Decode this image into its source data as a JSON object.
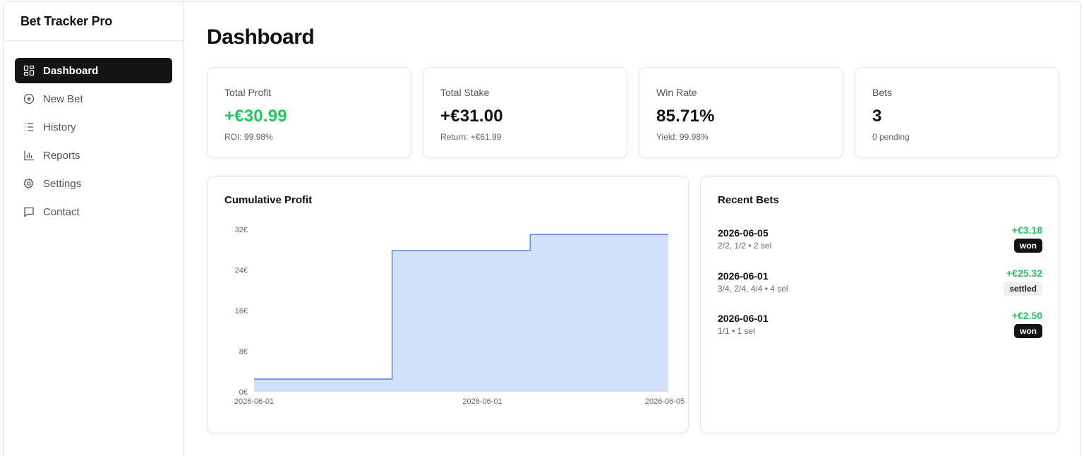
{
  "sidebar": {
    "brand": "Bet Tracker Pro",
    "items": [
      {
        "label": "Dashboard",
        "icon": "dashboard-icon",
        "active": true
      },
      {
        "label": "New Bet",
        "icon": "plus-circle-icon",
        "active": false
      },
      {
        "label": "History",
        "icon": "list-icon",
        "active": false
      },
      {
        "label": "Reports",
        "icon": "bar-chart-icon",
        "active": false
      },
      {
        "label": "Settings",
        "icon": "gear-icon",
        "active": false
      },
      {
        "label": "Contact",
        "icon": "message-icon",
        "active": false
      }
    ]
  },
  "main": {
    "title": "Dashboard",
    "stats": [
      {
        "label": "Total Profit",
        "value": "+€30.99",
        "sub": "ROI: 99.98%"
      },
      {
        "label": "Total Stake",
        "value": "+€31.00",
        "sub": "Return: +€61.99"
      },
      {
        "label": "Win Rate",
        "value": "85.71%",
        "sub": "Yield: 99.98%"
      },
      {
        "label": "Bets",
        "value": "3",
        "sub": "0 pending"
      }
    ],
    "chart_panel": {
      "title": "Cumulative Profit"
    },
    "recent": {
      "title": "Recent Bets",
      "bets": [
        {
          "date": "2026-06-05",
          "meta": "2/2, 1/2 • 2 sel",
          "amount": "+€3.18",
          "status": "won"
        },
        {
          "date": "2026-06-01",
          "meta": "3/4, 2/4, 4/4 • 4 sel",
          "amount": "+€25.32",
          "status": "settled"
        },
        {
          "date": "2026-06-01",
          "meta": "1/1 • 1 sel",
          "amount": "+€2.50",
          "status": "won"
        }
      ]
    }
  },
  "colors": {
    "positive": "#22c55e",
    "area_fill": "#d3e0fa",
    "area_line": "#5b84e8",
    "active_nav": "#141414"
  },
  "chart_data": {
    "type": "area",
    "step": true,
    "x_ticks": [
      "2026-06-01",
      "2026-06-01",
      "2026-06-05"
    ],
    "y_ticks": [
      "0€",
      "8€",
      "16€",
      "24€",
      "32€"
    ],
    "ylim": [
      0,
      32
    ],
    "points": [
      {
        "x": 0,
        "y": 2.5
      },
      {
        "x": 1,
        "y": 27.82
      },
      {
        "x": 2,
        "y": 30.99
      }
    ]
  }
}
